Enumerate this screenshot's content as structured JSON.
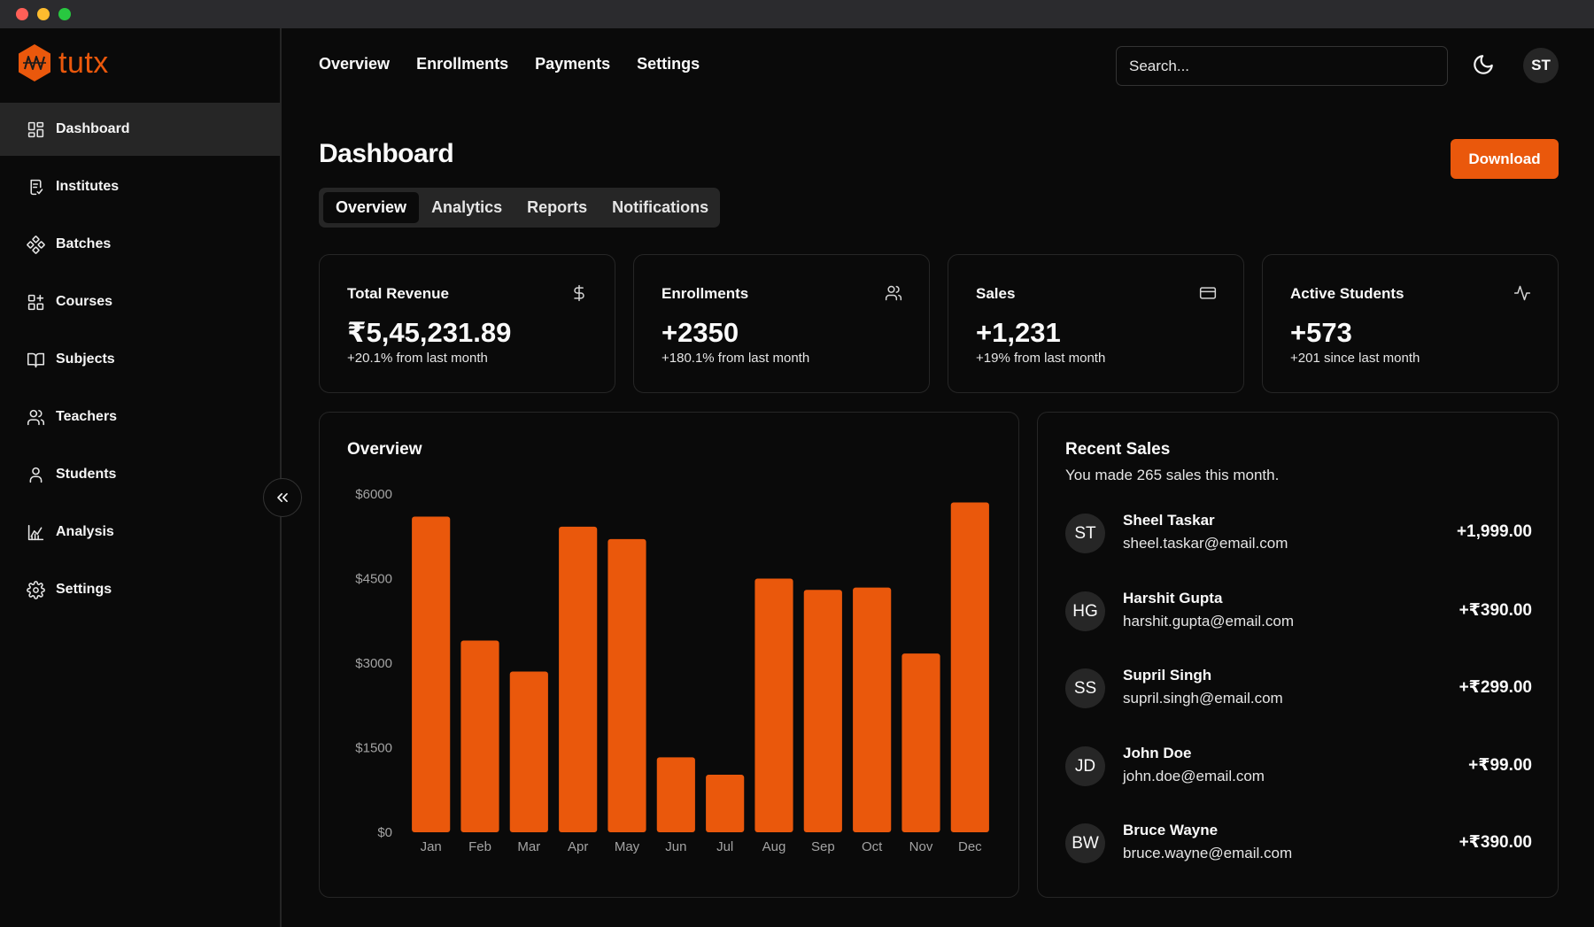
{
  "app": {
    "logo_text": "tutx"
  },
  "sidebar": {
    "items": [
      {
        "label": "Dashboard",
        "icon": "dashboard-icon",
        "active": true
      },
      {
        "label": "Institutes",
        "icon": "institutes-icon"
      },
      {
        "label": "Batches",
        "icon": "batches-icon"
      },
      {
        "label": "Courses",
        "icon": "courses-icon"
      },
      {
        "label": "Subjects",
        "icon": "book-icon"
      },
      {
        "label": "Teachers",
        "icon": "users-icon"
      },
      {
        "label": "Students",
        "icon": "user-icon"
      },
      {
        "label": "Analysis",
        "icon": "chart-icon"
      },
      {
        "label": "Settings",
        "icon": "gear-icon"
      }
    ],
    "collapse_icon": "chevrons-left-icon"
  },
  "header": {
    "nav": [
      "Overview",
      "Enrollments",
      "Payments",
      "Settings"
    ],
    "search_placeholder": "Search...",
    "theme_icon": "moon-icon",
    "user_initials": "ST"
  },
  "page": {
    "title": "Dashboard",
    "download_label": "Download",
    "tabs": [
      {
        "label": "Overview",
        "active": true
      },
      {
        "label": "Analytics"
      },
      {
        "label": "Reports"
      },
      {
        "label": "Notifications"
      }
    ]
  },
  "stats": [
    {
      "label": "Total Revenue",
      "value": "₹5,45,231.89",
      "sub": "+20.1% from last month",
      "icon": "dollar-icon"
    },
    {
      "label": "Enrollments",
      "value": "+2350",
      "sub": "+180.1% from last month",
      "icon": "users-icon"
    },
    {
      "label": "Sales",
      "value": "+1,231",
      "sub": "+19% from last month",
      "icon": "credit-card-icon"
    },
    {
      "label": "Active Students",
      "value": "+573",
      "sub": "+201 since last month",
      "icon": "activity-icon"
    }
  ],
  "overview": {
    "title": "Overview",
    "bar_color": "#ea580c"
  },
  "chart_data": {
    "type": "bar",
    "categories": [
      "Jan",
      "Feb",
      "Mar",
      "Apr",
      "May",
      "Jun",
      "Jul",
      "Aug",
      "Sep",
      "Oct",
      "Nov",
      "Dec"
    ],
    "values": [
      5600,
      3400,
      2850,
      5420,
      5200,
      1330,
      1020,
      4500,
      4300,
      4340,
      3170,
      5850
    ],
    "yticks": [
      "$0",
      "$1500",
      "$3000",
      "$4500",
      "$6000"
    ],
    "ylim": [
      0,
      6000
    ],
    "grid": false
  },
  "recent_sales": {
    "title": "Recent Sales",
    "description": "You made 265 sales this month.",
    "items": [
      {
        "initials": "ST",
        "name": "Sheel Taskar",
        "email": "sheel.taskar@email.com",
        "amount": "+1,999.00"
      },
      {
        "initials": "HG",
        "name": "Harshit Gupta",
        "email": "harshit.gupta@email.com",
        "amount": "+₹390.00"
      },
      {
        "initials": "SS",
        "name": "Supril Singh",
        "email": "supril.singh@email.com",
        "amount": "+₹299.00"
      },
      {
        "initials": "JD",
        "name": "John Doe",
        "email": "john.doe@email.com",
        "amount": "+₹99.00"
      },
      {
        "initials": "BW",
        "name": "Bruce Wayne",
        "email": "bruce.wayne@email.com",
        "amount": "+₹390.00"
      }
    ]
  }
}
